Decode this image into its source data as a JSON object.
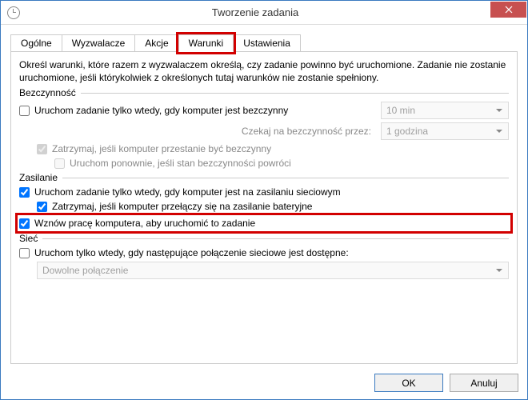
{
  "window": {
    "title": "Tworzenie zadania"
  },
  "tabs": {
    "general": "Ogólne",
    "triggers": "Wyzwalacze",
    "actions": "Akcje",
    "conditions": "Warunki",
    "settings": "Ustawienia"
  },
  "panel": {
    "desc": "Określ warunki, które razem z wyzwalaczem określą, czy zadanie powinno być uruchomione. Zadanie nie zostanie uruchomione, jeśli którykolwiek z określonych tutaj warunków nie zostanie spełniony.",
    "idle_section": "Bezczynność",
    "run_only_idle": "Uruchom zadanie tylko wtedy, gdy komputer jest bezczynny",
    "idle_duration": "10 min",
    "wait_for_idle_label": "Czekaj na bezczynność przez:",
    "wait_for_idle_value": "1 godzina",
    "stop_if_not_idle": "Zatrzymaj, jeśli komputer przestanie być bezczynny",
    "restart_if_idle": "Uruchom ponownie, jeśli stan bezczynności powróci",
    "power_section": "Zasilanie",
    "run_only_ac": "Uruchom zadanie tylko wtedy, gdy komputer jest na zasilaniu sieciowym",
    "stop_on_battery": "Zatrzymaj, jeśli komputer przełączy się na zasilanie bateryjne",
    "wake_to_run": "Wznów pracę komputera, aby uruchomić to zadanie",
    "network_section": "Sieć",
    "run_only_network": "Uruchom tylko wtedy, gdy następujące połączenie sieciowe jest dostępne:",
    "any_connection": "Dowolne połączenie"
  },
  "buttons": {
    "ok": "OK",
    "cancel": "Anuluj"
  }
}
